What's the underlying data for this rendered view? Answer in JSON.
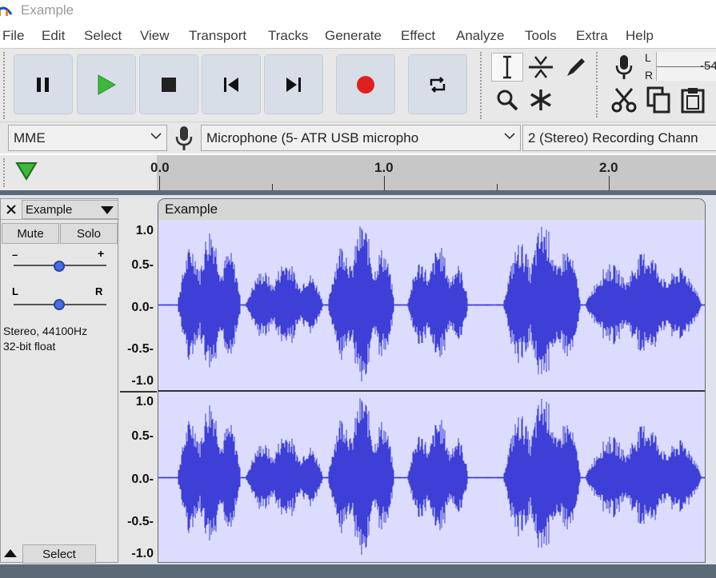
{
  "window": {
    "title": "Example"
  },
  "menu": [
    "File",
    "Edit",
    "Select",
    "View",
    "Transport",
    "Tracks",
    "Generate",
    "Effect",
    "Analyze",
    "Tools",
    "Extra",
    "Help"
  ],
  "transport": {
    "buttons": [
      "pause-icon",
      "play-icon",
      "stop-icon",
      "skip-start-icon",
      "skip-end-icon",
      "record-icon",
      "loop-icon"
    ]
  },
  "tools": [
    "selection-tool-icon",
    "envelope-tool-icon",
    "draw-tool-icon",
    "zoom-tool-icon",
    "multi-tool-icon"
  ],
  "edit_tools": [
    "cut-icon",
    "copy-icon",
    "paste-icon"
  ],
  "meter": {
    "left": "L",
    "right": "R",
    "scale_value": "-54"
  },
  "devices": {
    "host": "MME",
    "input": "Microphone (5- ATR USB micropho",
    "channels": "2 (Stereo) Recording Chann"
  },
  "ruler": {
    "labels": [
      "0.0",
      "1.0",
      "2.0"
    ]
  },
  "track": {
    "name": "Example",
    "mute": "Mute",
    "solo": "Solo",
    "gain_minus": "–",
    "gain_plus": "+",
    "pan_left": "L",
    "pan_right": "R",
    "info_line1": "Stereo, 44100Hz",
    "info_line2": "32-bit float",
    "select": "Select",
    "clip_name": "Example",
    "amplitude_labels": [
      "1.0",
      "0.5-",
      "0.0-",
      "-0.5-",
      "-1.0"
    ]
  },
  "colors": {
    "waveform": "#3d3fd6",
    "waveform_bg": "#dcdcff",
    "record": "#e0201e",
    "play": "#3db83d"
  }
}
